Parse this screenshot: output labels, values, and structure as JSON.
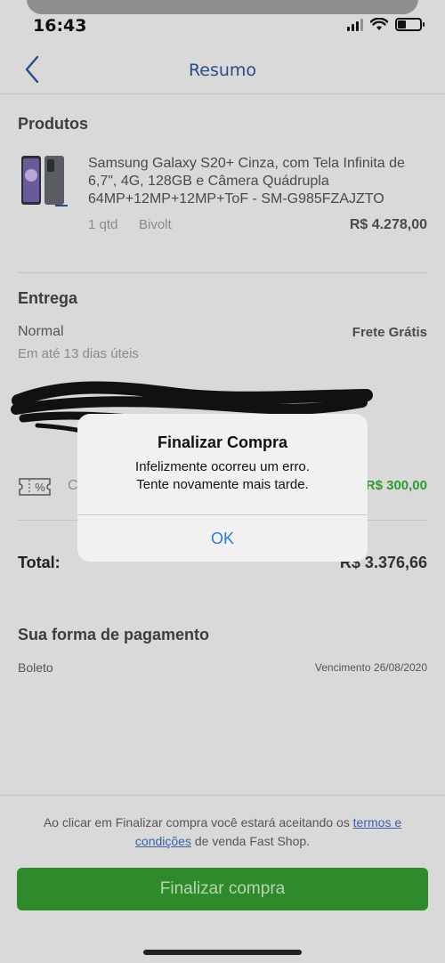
{
  "status_bar": {
    "time": "16:43"
  },
  "nav": {
    "title": "Resumo"
  },
  "produtos": {
    "title": "Produtos",
    "product": {
      "name": "Samsung Galaxy S20+ Cinza, com Tela Infinita de 6,7\", 4G, 128GB e Câmera Quádrupla 64MP+12MP+12MP+ToF - SM-G985FZAJZTO",
      "qty": "1 qtd",
      "voltage": "Bivolt",
      "price": "R$ 4.278,00"
    }
  },
  "entrega": {
    "title": "Entrega",
    "type": "Normal",
    "shipping_price": "Frete Grátis",
    "deadline": "Em até 13 dias úteis"
  },
  "coupon": {
    "icon": "percent-ticket-icon",
    "partial_label": "C",
    "discount": "R$ 300,00"
  },
  "total": {
    "label": "Total:",
    "value": "R$ 3.376,66"
  },
  "pagamento": {
    "title": "Sua forma de pagamento",
    "method": "Boleto",
    "due": "Vencimento 26/08/2020"
  },
  "footer": {
    "legal_prefix": "Ao clicar em Finalizar compra você estará aceitando os ",
    "legal_link": "termos e condições",
    "legal_suffix": " de venda Fast Shop.",
    "button": "Finalizar compra"
  },
  "alert": {
    "title": "Finalizar Compra",
    "message_line1": "Infelizmente ocorreu um erro.",
    "message_line2": "Tente novamente mais tarde.",
    "ok": "OK"
  },
  "colors": {
    "accent_blue": "#2a4a8a",
    "green": "#2f8a2c",
    "alert_button": "#2f7bd6"
  }
}
